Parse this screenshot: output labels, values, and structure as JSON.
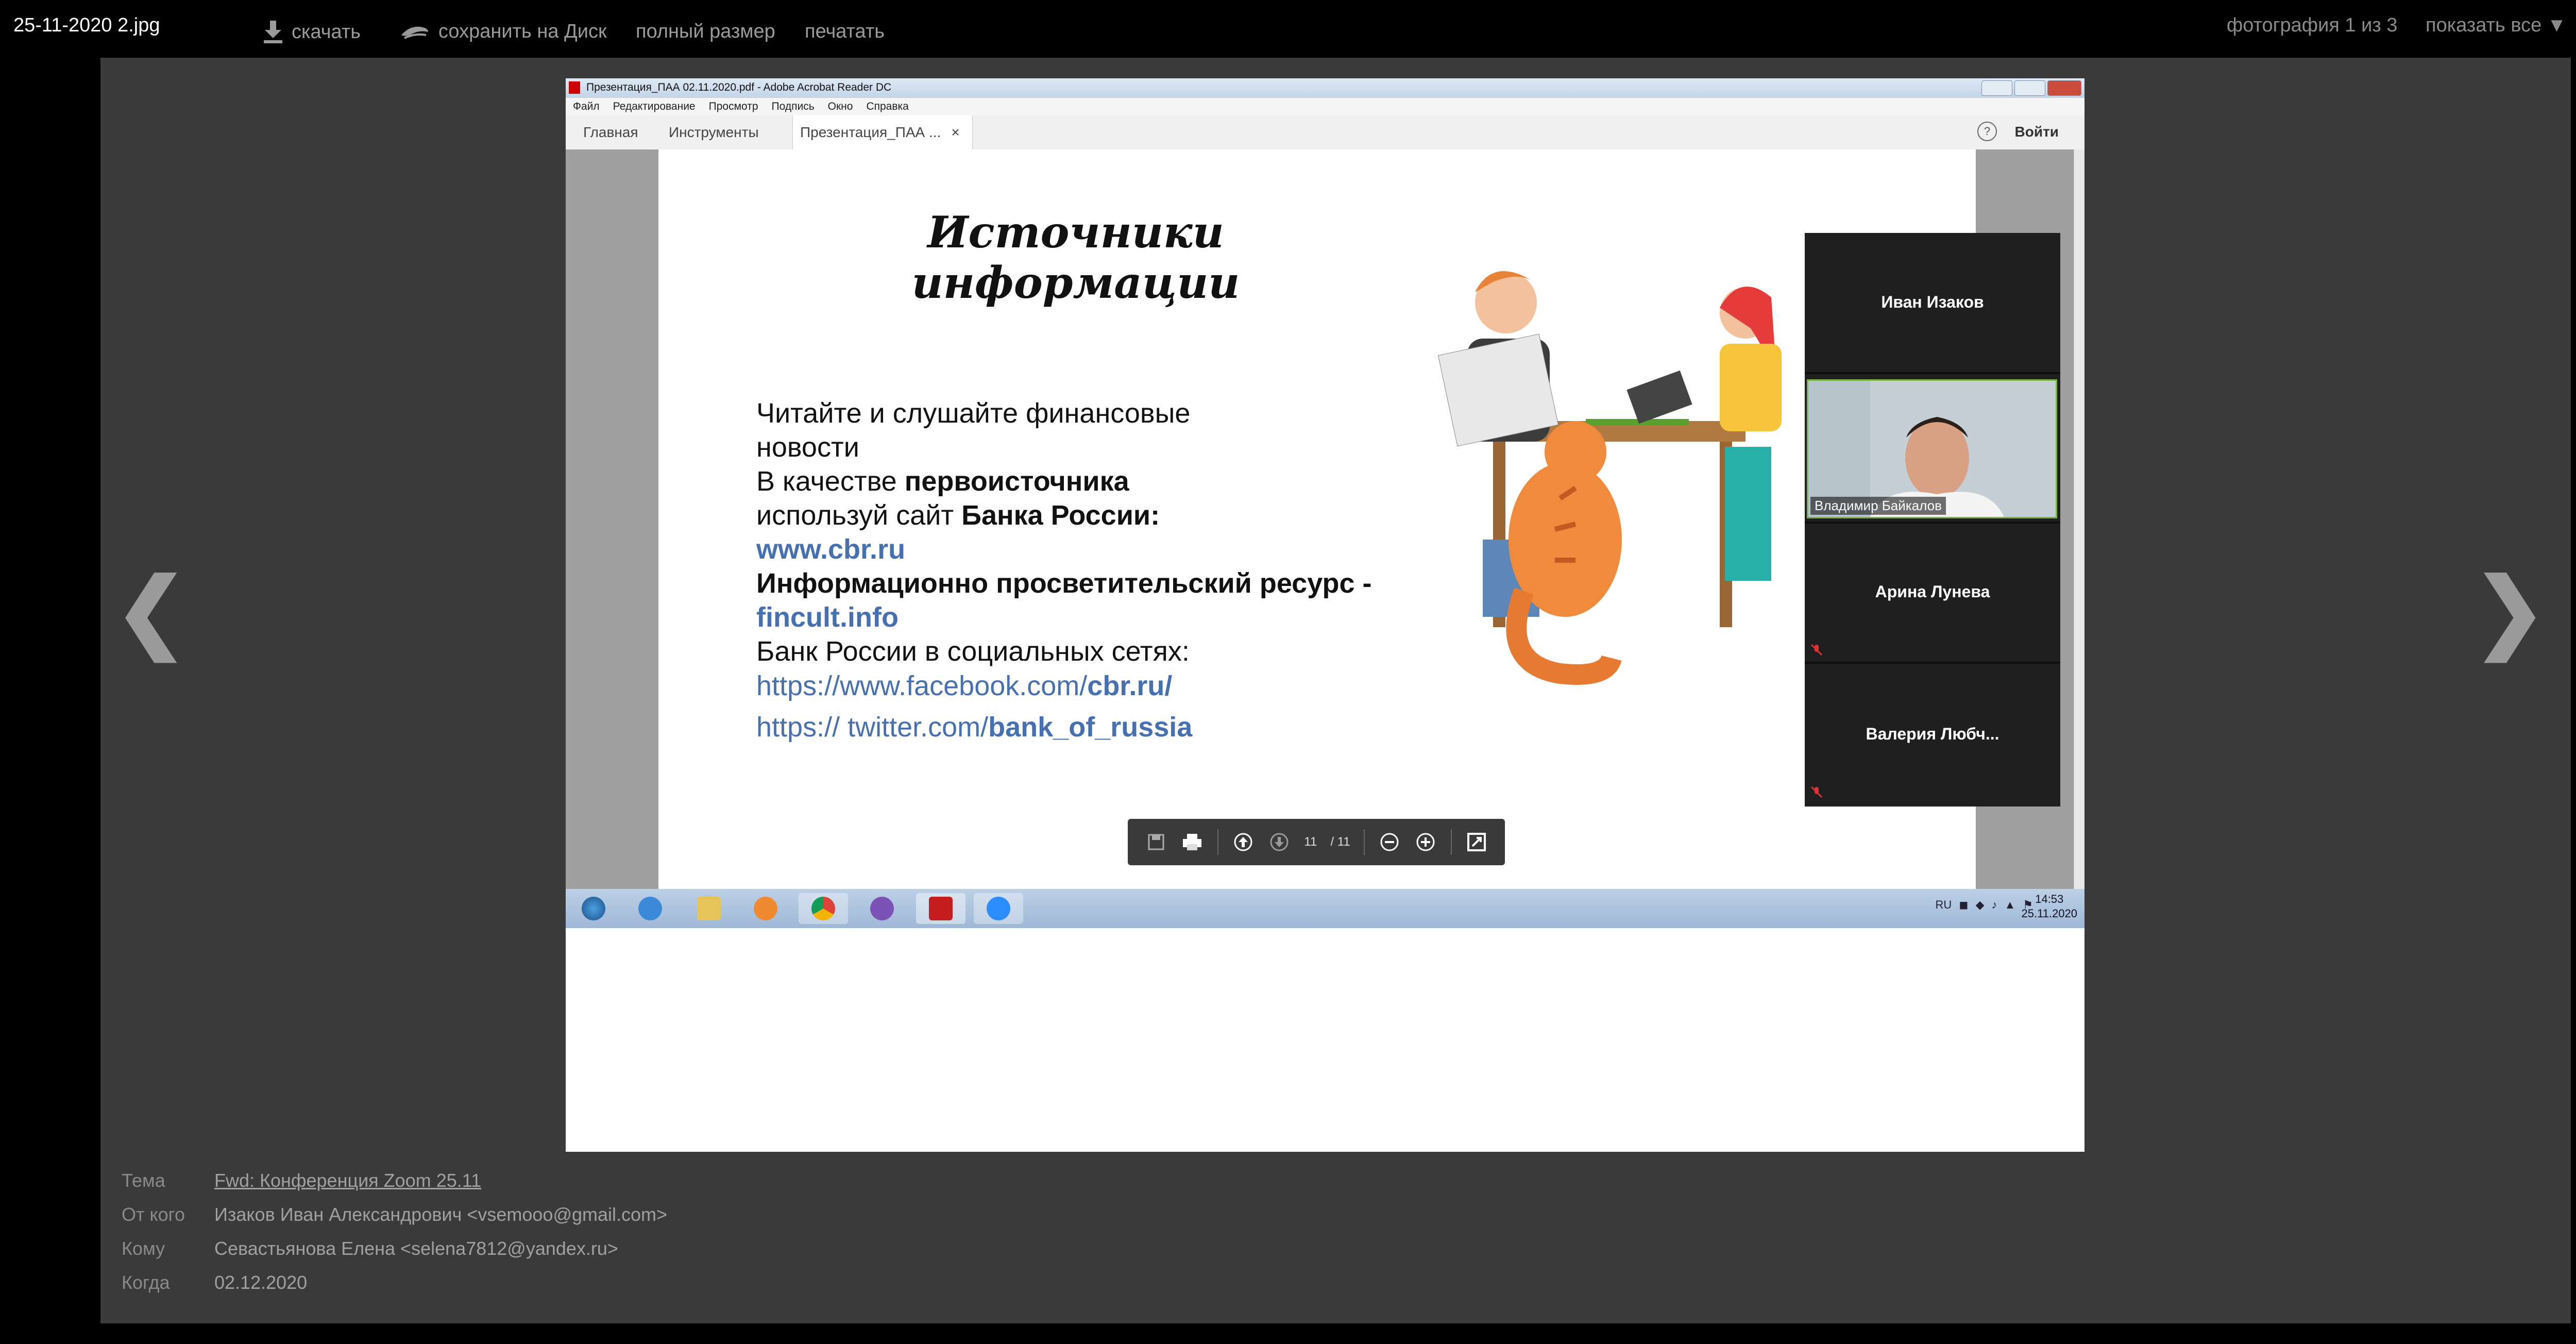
{
  "viewer": {
    "file_name": "25-11-2020 2.jpg",
    "download_label": "скачать",
    "save_disk_label": "сохранить на Диск",
    "full_size_label": "полный размер",
    "print_label": "печатать",
    "counter": "фотография 1 из 3",
    "show_all_label": "показать все ▼",
    "close_glyph": "✕",
    "prev_glyph": "❮",
    "next_glyph": "❯"
  },
  "acrobat": {
    "window_title": "Презентация_ПАА 02.11.2020.pdf - Adobe Acrobat Reader DC",
    "menu": [
      "Файл",
      "Редактирование",
      "Просмотр",
      "Подпись",
      "Окно",
      "Справка"
    ],
    "tabs": {
      "home": "Главная",
      "tools": "Инструменты",
      "doc": "Презентация_ПАА ...",
      "doc_close": "×"
    },
    "help": "?",
    "login": "Войти",
    "page_indicator": {
      "current": "11",
      "total": "/ 11"
    }
  },
  "slide": {
    "title_line1": "Источники",
    "title_line2": "информации",
    "p1": "Читайте и слушайте финансовые новости",
    "p2_pre": "В качестве ",
    "p2_bold": "первоисточника",
    "p2_mid": "используй сайт ",
    "p2_bold2": "Банка России:",
    "link1": "www.cbr.ru",
    "p3_bold": "Информационно просветительский ресурс - ",
    "link2": "fincult.info",
    "p4": "Банк России в социальных сетях:",
    "fb_pre": "https://www.facebook.com/",
    "fb_bold": "cbr.ru/",
    "tw_pre": "https:// twitter.com/",
    "tw_bold": "bank_of_russia"
  },
  "zoom": {
    "p1": "Иван Изаков",
    "p2": "Владимир Байкалов",
    "p3": "Арина Лунева",
    "p4": "Валерия  Любч..."
  },
  "taskbar": {
    "lang": "RU",
    "time": "14:53",
    "date": "25.11.2020"
  },
  "email_meta": {
    "subject_label": "Тема",
    "subject": "Fwd: Конференция Zoom 25.11",
    "from_label": "От кого",
    "from": "Изаков Иван Александрович <vsemooo@gmail.com>",
    "to_label": "Кому",
    "to": "Севастьянова Елена <selena7812@yandex.ru>",
    "when_label": "Когда",
    "when": "02.12.2020"
  },
  "colors": {
    "accent_link": "#4670b0",
    "zoom_active": "#7ab544"
  }
}
